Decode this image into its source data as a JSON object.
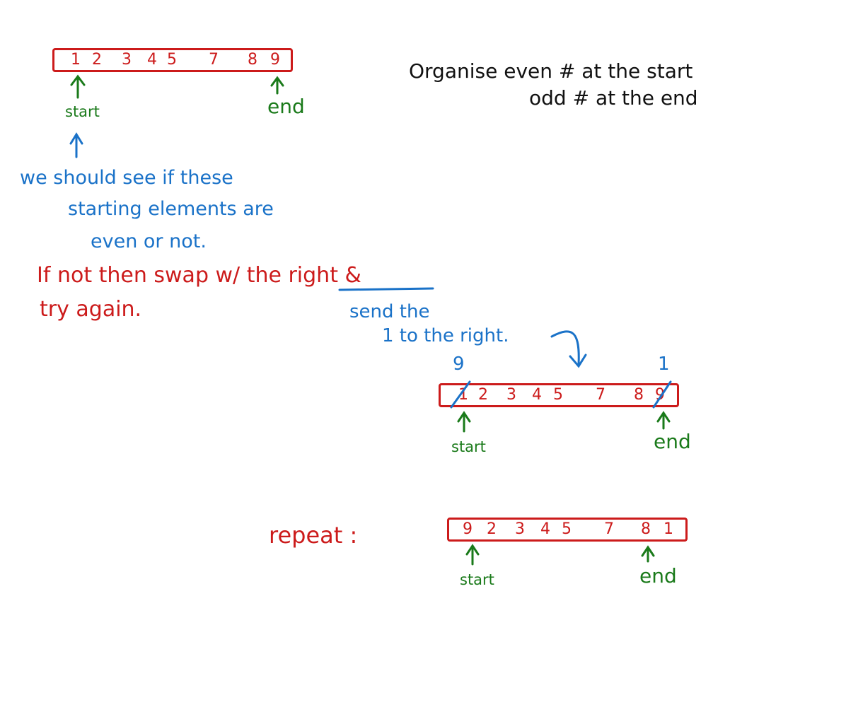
{
  "array1": {
    "numbers": [
      "1",
      "2",
      "3",
      "4",
      "5",
      "7",
      "8",
      "9"
    ],
    "start_label": "start",
    "end_label": "end"
  },
  "goal": {
    "line1": "Organise   even # at the start",
    "line2": "odd # at the end"
  },
  "note_blue": {
    "line1": "we should see if these",
    "line2": "starting elements are",
    "line3": "even or not."
  },
  "note_red": {
    "line1": "If not  then  swap w/ the right &",
    "line2": "try again."
  },
  "note_send": {
    "line1": "send the",
    "line2": "1 to the right."
  },
  "array2": {
    "numbers": [
      "1",
      "2",
      "3",
      "4",
      "5",
      "7",
      "8",
      "9"
    ],
    "above_left": "9",
    "above_right": "1",
    "start_label": "start",
    "end_label": "end"
  },
  "repeat": {
    "label": "repeat :"
  },
  "array3": {
    "numbers": [
      "9",
      "2",
      "3",
      "4",
      "5",
      "7",
      "8",
      "1"
    ],
    "start_label": "start",
    "end_label": "end"
  },
  "colors": {
    "red": "#cc1b1b",
    "blue": "#1a72c8",
    "green": "#1a7a1a",
    "black": "#111111"
  }
}
